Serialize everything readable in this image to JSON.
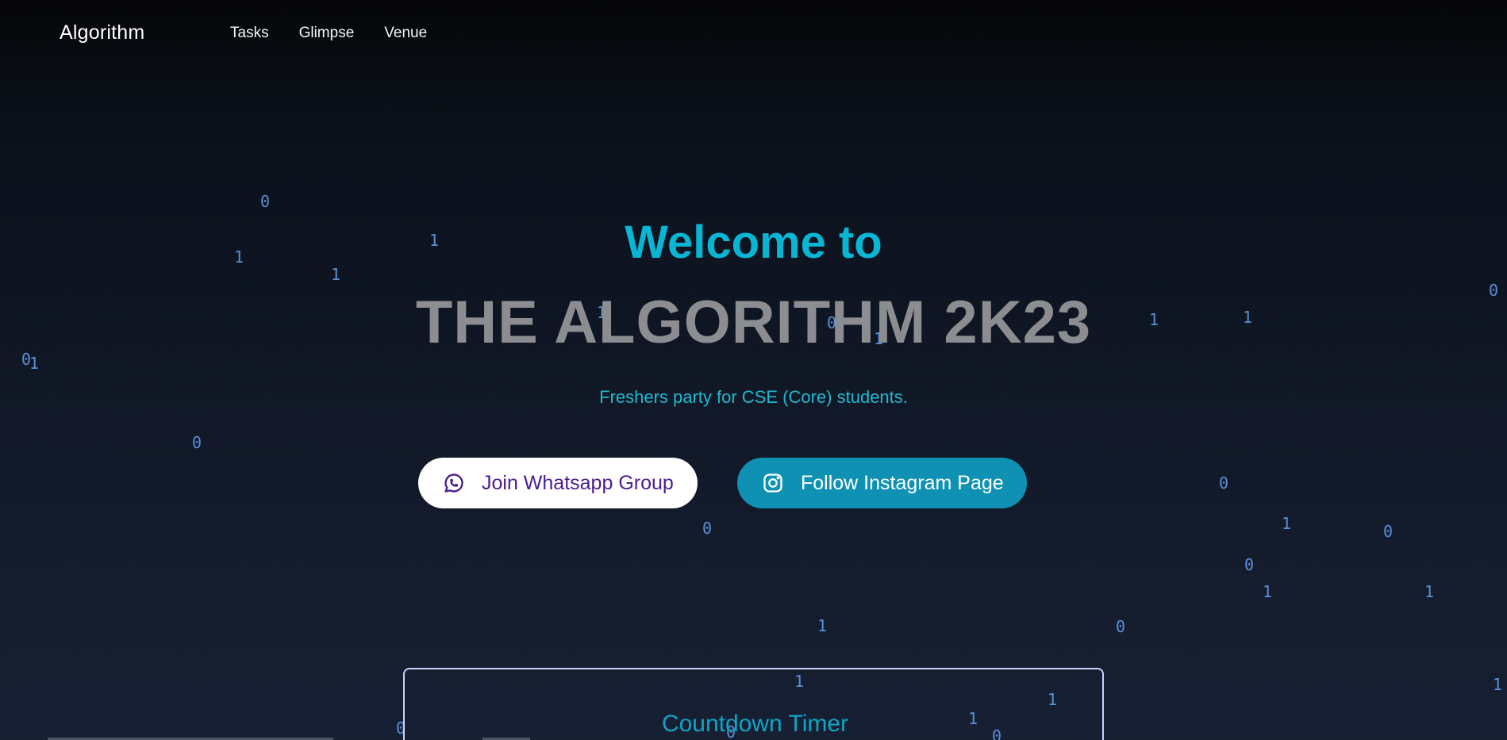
{
  "nav": {
    "brand": "Algorithm",
    "links": [
      "Tasks",
      "Glimpse",
      "Venue"
    ]
  },
  "hero": {
    "welcome": "Welcome to",
    "title": "THE ALGORITHM 2K23",
    "subtitle": "Freshers party for CSE (Core) students.",
    "whatsapp_button": "Join Whatsapp Group",
    "instagram_button": "Follow Instagram Page"
  },
  "countdown": {
    "title": "Countdown Timer"
  },
  "binary_digits": [
    "0",
    "1",
    "1",
    "1",
    "0",
    "1",
    "0",
    "1",
    "0",
    "1",
    "1",
    "0",
    "1",
    "0",
    "0",
    "1",
    "0",
    "1",
    "0",
    "1",
    "0",
    "1",
    "0",
    "1",
    "1",
    "1",
    "0",
    "0",
    "1",
    "0",
    "1"
  ],
  "colors": {
    "accent_cyan": "#06b6d4",
    "title_gray": "#8b8d91",
    "binary_blue": "#5b8fd6",
    "whatsapp_text": "#4b1d8f",
    "instagram_bg": "#0e91b3",
    "countdown_border": "#c7d2fe"
  },
  "icons": {
    "whatsapp": "whatsapp-icon",
    "instagram": "instagram-icon"
  }
}
